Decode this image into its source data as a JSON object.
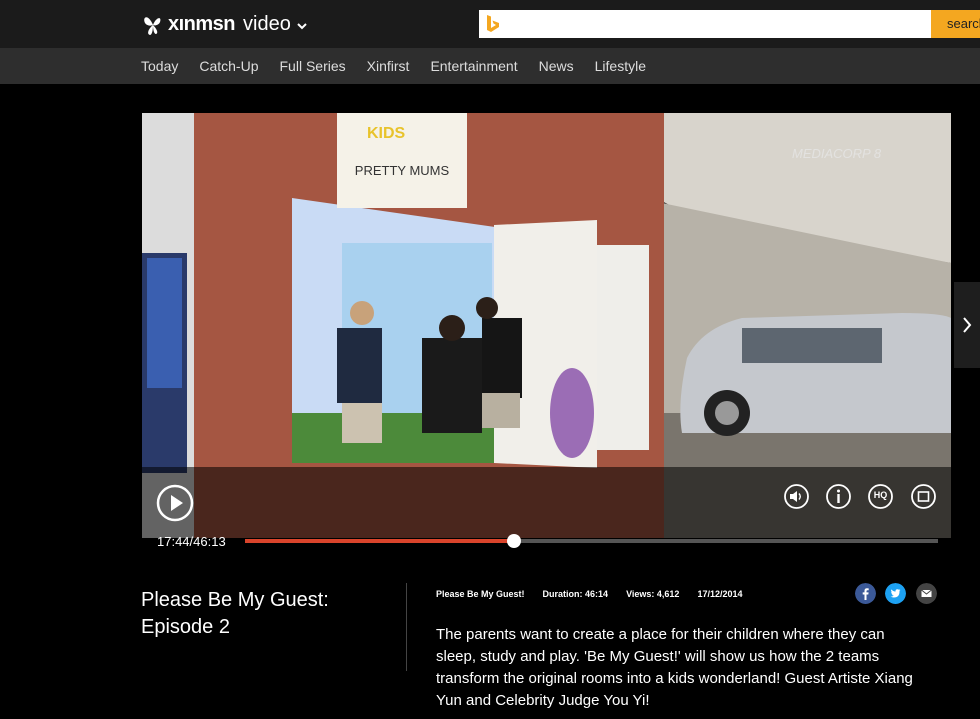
{
  "header": {
    "logo_text": "xınmsn",
    "section": "video",
    "search_placeholder": "",
    "search_button": "search"
  },
  "nav": {
    "items": [
      "Today",
      "Catch-Up",
      "Full Series",
      "Xinfirst",
      "Entertainment",
      "News",
      "Lifestyle"
    ]
  },
  "video": {
    "watermark": "MEDIACORP 8",
    "sign_text": "PRETTY MUMS",
    "sign_brand": "KIDS",
    "current_time": "17:44",
    "duration_time": "46:13",
    "timecode": "17:44/46:13",
    "progress_fraction": 0.388,
    "controls": [
      "volume-icon",
      "info-icon",
      "hq-icon",
      "fullscreen-icon"
    ],
    "hq_label": "HQ"
  },
  "episode": {
    "title_line1": "Please Be My Guest:",
    "title_line2": "Episode 2",
    "show": "Please Be My Guest!",
    "duration": "Duration: 46:14",
    "views": "Views: 4,612",
    "date": "17/12/2014",
    "description": "The parents want to create a place for their children where they can sleep, study and play. 'Be My Guest!' will show us how the 2 teams transform the original rooms into a kids wonderland! Guest Artiste Xiang Yun and Celebrity Judge You Yi!"
  },
  "colors": {
    "accent": "#f4a720",
    "progress": "#d9442b",
    "facebook": "#3b5998",
    "twitter": "#1da1f2",
    "email": "#444444"
  }
}
